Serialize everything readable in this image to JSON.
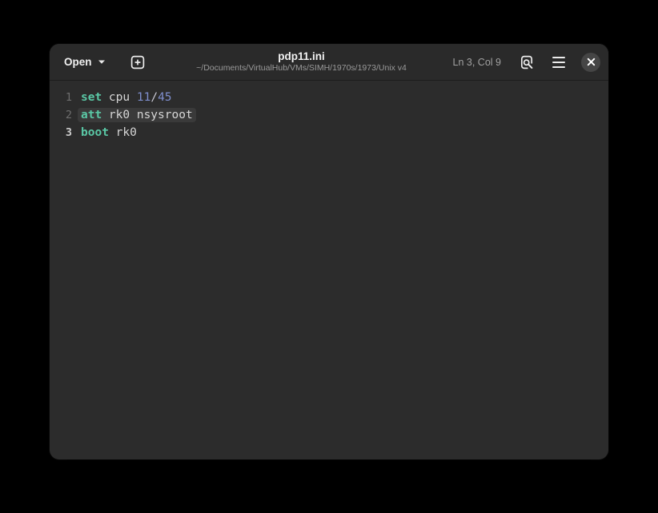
{
  "window": {
    "header": {
      "open_label": "Open",
      "title": "pdp11.ini",
      "subtitle": "~/Documents/VirtualHub/VMs/SIMH/1970s/1973/Unix v4",
      "cursor_position": "Ln 3, Col 9",
      "icons": [
        "chevron-down-icon",
        "new-tab-icon",
        "search-document-icon",
        "menu-icon",
        "close-icon"
      ]
    },
    "editor": {
      "lines": [
        {
          "number": "1",
          "current": false,
          "highlighted": false,
          "tokens": [
            {
              "text": "set",
              "type": "keyword"
            },
            {
              "text": " cpu ",
              "type": "plain"
            },
            {
              "text": "11",
              "type": "number"
            },
            {
              "text": "/",
              "type": "operator"
            },
            {
              "text": "45",
              "type": "number"
            }
          ]
        },
        {
          "number": "2",
          "current": false,
          "highlighted": true,
          "tokens": [
            {
              "text": "att",
              "type": "keyword"
            },
            {
              "text": " rk0 nsysroot",
              "type": "plain"
            }
          ]
        },
        {
          "number": "3",
          "current": true,
          "highlighted": false,
          "tokens": [
            {
              "text": "boot",
              "type": "keyword"
            },
            {
              "text": " rk0",
              "type": "plain"
            }
          ]
        }
      ]
    }
  },
  "colors": {
    "desktop_bg": "#000000",
    "window_bg": "#2c2c2c",
    "header_bg": "#2a2a2a",
    "header_border": "#1d1d1d",
    "title_fg": "#f2f2f2",
    "subtitle_fg": "#9a9a9a",
    "text_fg": "#d6d6d6",
    "keyword": "#5ac7a5",
    "number": "#7e8ecd",
    "operator": "#c8c8d4",
    "line_number": "#6e6e6e",
    "line_number_current": "#cccccc",
    "line_highlight": "#3a3a3a",
    "close_button_bg": "#454545"
  }
}
